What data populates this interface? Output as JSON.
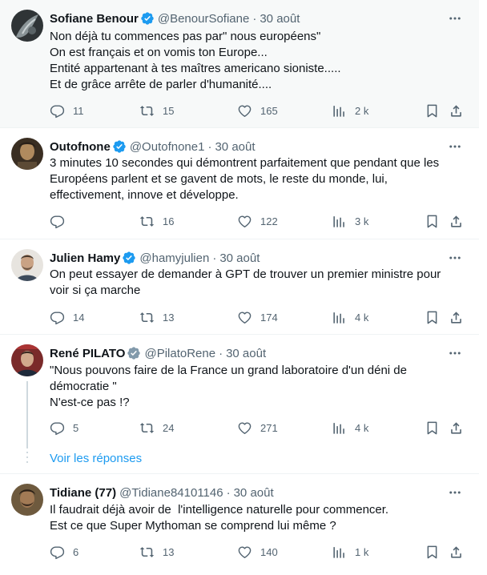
{
  "tweets": [
    {
      "name": "Sofiane Benour",
      "verified": "blue",
      "handle": "@BenourSofiane",
      "date": "30 août",
      "lines": [
        "Non déjà tu commences pas par\" nous européens\"",
        "On est français et on vomis ton Europe...",
        "Entité appartenant à tes maîtres americano sioniste.....",
        "Et de grâce arrête de parler d'humanité...."
      ],
      "replies": "11",
      "retweets": "15",
      "likes": "165",
      "views": "2 k"
    },
    {
      "name": "Outofnone",
      "verified": "blue",
      "handle": "@Outofnone1",
      "date": "30 août",
      "lines": [
        "3 minutes 10 secondes qui démontrent parfaitement que pendant que les",
        "Européens parlent et se gavent de mots, le reste du monde, lui,",
        "effectivement, innove et développe."
      ],
      "replies": "",
      "retweets": "16",
      "likes": "122",
      "views": "3 k"
    },
    {
      "name": "Julien Hamy",
      "verified": "blue",
      "handle": "@hamyjulien",
      "date": "30 août",
      "lines": [
        "On peut essayer de demander à GPT de trouver un premier ministre pour",
        "voir si ça marche"
      ],
      "replies": "14",
      "retweets": "13",
      "likes": "174",
      "views": "4 k"
    },
    {
      "name": "René PILATO",
      "verified": "gray",
      "handle": "@PilatoRene",
      "date": "30 août",
      "lines": [
        "\"Nous pouvons faire de la France un grand laboratoire d'un déni de",
        "démocratie \"",
        "N'est-ce pas !?"
      ],
      "replies": "5",
      "retweets": "24",
      "likes": "271",
      "views": "4 k",
      "show_replies": "Voir les réponses"
    },
    {
      "name": "Tidiane (77)",
      "verified": "none",
      "handle": "@Tidiane84101146",
      "date": "30 août",
      "lines": [
        "Il faudrait déjà avoir de  l'intelligence naturelle pour commencer.",
        "Est ce que Super Mythoman se comprend lui même ?"
      ],
      "replies": "6",
      "retweets": "13",
      "likes": "140",
      "views": "1 k"
    }
  ],
  "separator": "·",
  "colors": {
    "verified_blue": "#1d9bf0",
    "verified_gray": "#829aab",
    "text_primary": "#0f1419",
    "text_secondary": "#536471",
    "link": "#1d9bf0",
    "highlight_bg": "#f7f9f9"
  },
  "icons": {
    "more": "more-horizontal-icon",
    "reply": "reply-bubble-icon",
    "retweet": "retweet-icon",
    "like": "heart-icon",
    "views": "views-bar-chart-icon",
    "bookmark": "bookmark-icon",
    "share": "share-upload-icon",
    "verified": "verified-check-badge-icon"
  }
}
